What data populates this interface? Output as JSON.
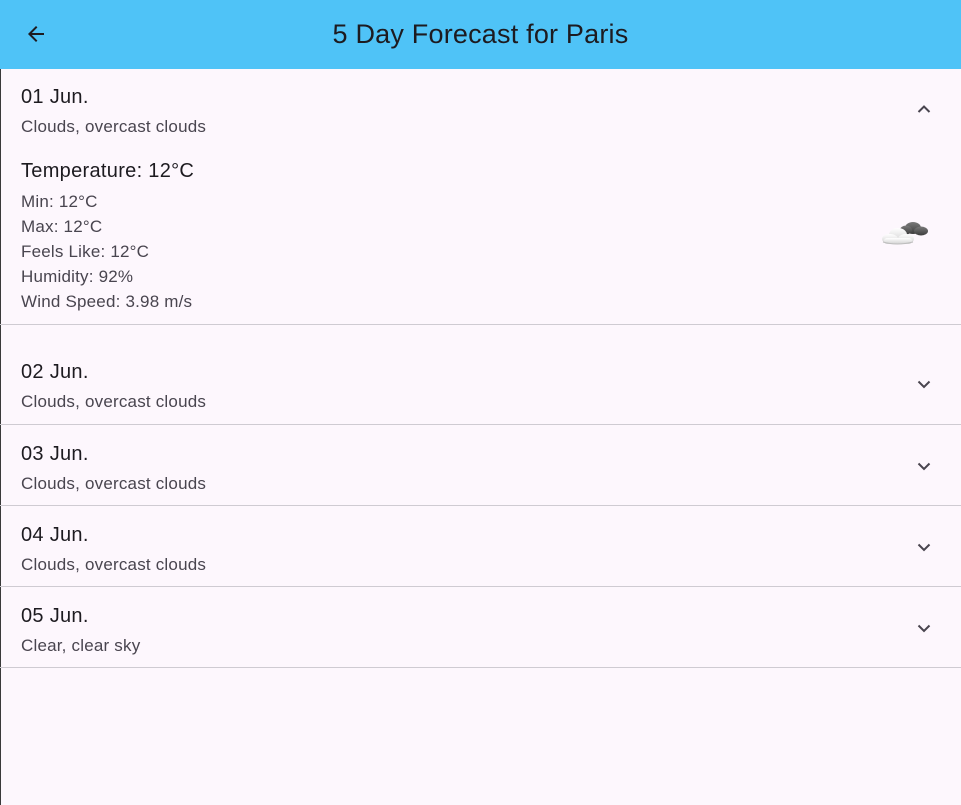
{
  "appbar": {
    "title": "5 Day Forecast for Paris",
    "back_icon": "arrow-back-icon",
    "color": "#4fc3f7"
  },
  "forecast": [
    {
      "date": "01 Jun.",
      "description": "Clouds, overcast clouds",
      "expanded": true,
      "chevron_icon": "chevron-up-icon",
      "details": {
        "temperature": "Temperature: 12°C",
        "min": "Min: 12°C",
        "max": "Max: 12°C",
        "feels_like": "Feels Like: 12°C",
        "humidity": "Humidity: 92%",
        "wind_speed": "Wind Speed: 3.98 m/s",
        "icon": "overcast-clouds-icon"
      }
    },
    {
      "date": "02 Jun.",
      "description": "Clouds, overcast clouds",
      "expanded": false,
      "chevron_icon": "chevron-down-icon"
    },
    {
      "date": "03 Jun.",
      "description": "Clouds, overcast clouds",
      "expanded": false,
      "chevron_icon": "chevron-down-icon"
    },
    {
      "date": "04 Jun.",
      "description": "Clouds, overcast clouds",
      "expanded": false,
      "chevron_icon": "chevron-down-icon"
    },
    {
      "date": "05 Jun.",
      "description": "Clear, clear sky",
      "expanded": false,
      "chevron_icon": "chevron-down-icon"
    }
  ]
}
